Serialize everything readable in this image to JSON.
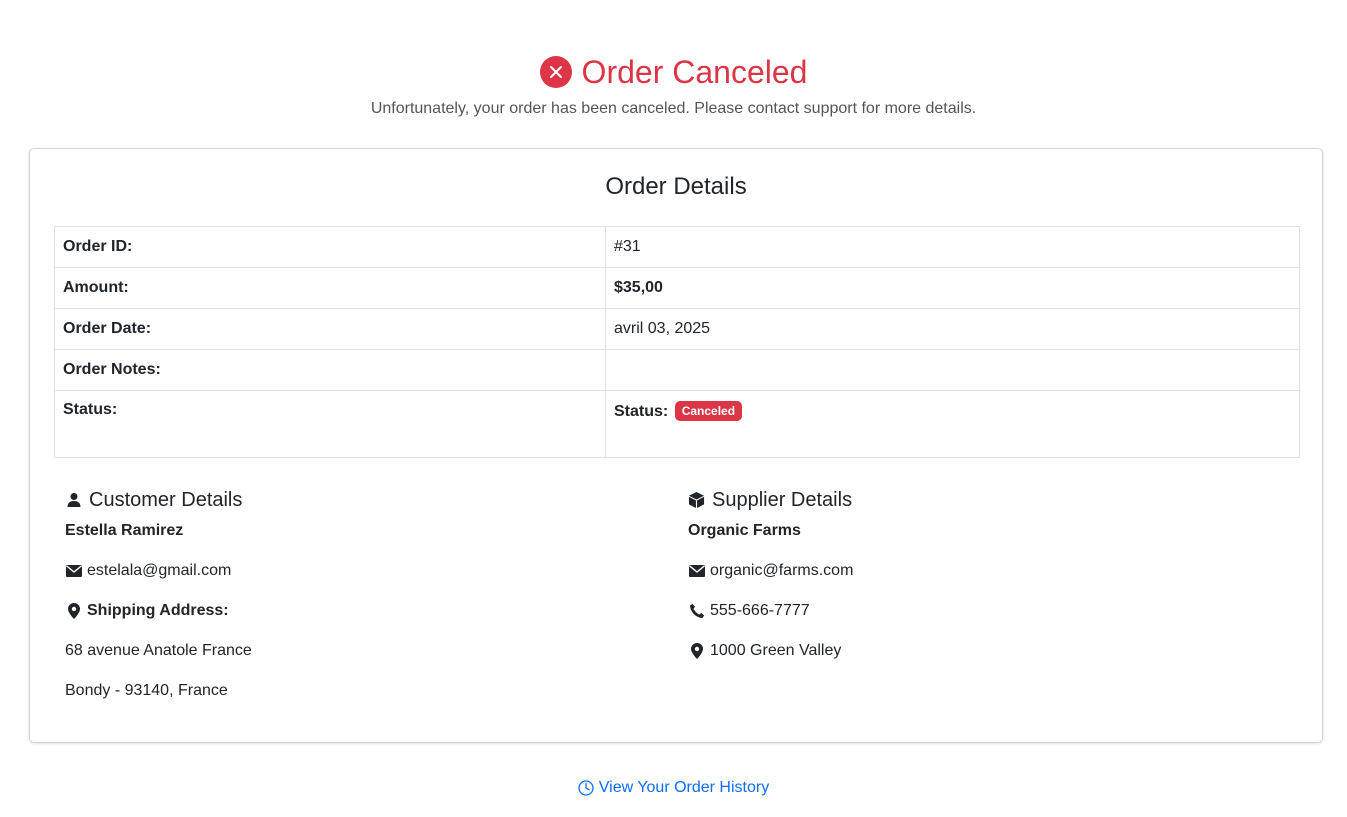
{
  "header": {
    "title": "Order Canceled",
    "subtitle": "Unfortunately, your order has been canceled. Please contact support for more details."
  },
  "card": {
    "title": "Order Details",
    "rows": [
      {
        "label": "Order ID:",
        "value": "#31"
      },
      {
        "label": "Amount:",
        "value": "$35,00"
      },
      {
        "label": "Order Date:",
        "value": "avril 03, 2025"
      },
      {
        "label": "Order Notes:",
        "value": ""
      },
      {
        "label": "Status:",
        "value_prefix": "Status:",
        "badge": "Canceled"
      }
    ]
  },
  "customer": {
    "heading": "Customer Details",
    "name": "Estella Ramirez",
    "email": "estelala@gmail.com",
    "shipping_label": "Shipping Address:",
    "address_line1": "68 avenue Anatole France",
    "address_line2": "Bondy - 93140, France"
  },
  "supplier": {
    "heading": "Supplier Details",
    "name": "Organic Farms",
    "email": "organic@farms.com",
    "phone": "555-666-7777",
    "address": "1000 Green Valley"
  },
  "footer": {
    "history_link": "View Your Order History"
  },
  "colors": {
    "danger": "#dc3545",
    "link": "#0d6efd"
  },
  "icons": [
    "x-circle-icon",
    "person-icon",
    "box-icon",
    "envelope-icon",
    "map-pin-icon",
    "phone-icon",
    "clock-icon"
  ]
}
